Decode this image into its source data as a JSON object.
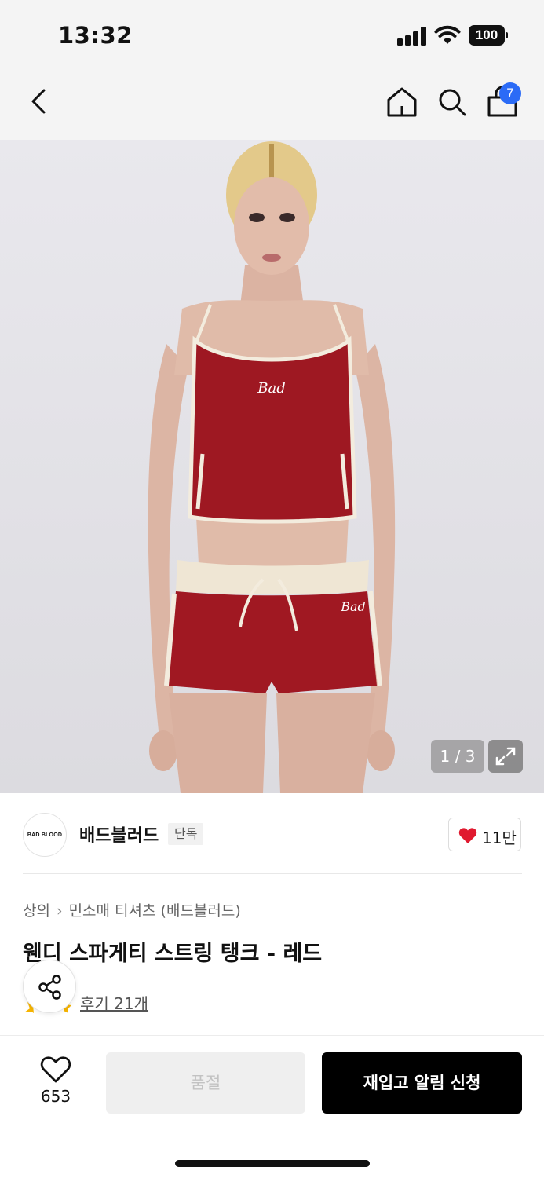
{
  "status_bar": {
    "time": "13:32",
    "battery": "100"
  },
  "header": {
    "cart_count": "7"
  },
  "image": {
    "counter": "1 / 3",
    "top_logo": "Bad",
    "shorts_logo": "Bad"
  },
  "brand": {
    "logo_text": "BAD BLOOD",
    "name": "배드블러드",
    "badge": "단독",
    "likes": "11만",
    "accent": "#e0192f"
  },
  "breadcrumb": {
    "category": "상의",
    "subcategory": "민소매 티셔츠 (배드블러드)"
  },
  "product": {
    "title": "웬디 스파게티 스트링 탱크 - 레드",
    "reviews": "후기 21개",
    "star_color": "#f7b500"
  },
  "bottom": {
    "wish_count": "653",
    "soldout_label": "품절",
    "restock_label": "재입고 알림 신청"
  }
}
